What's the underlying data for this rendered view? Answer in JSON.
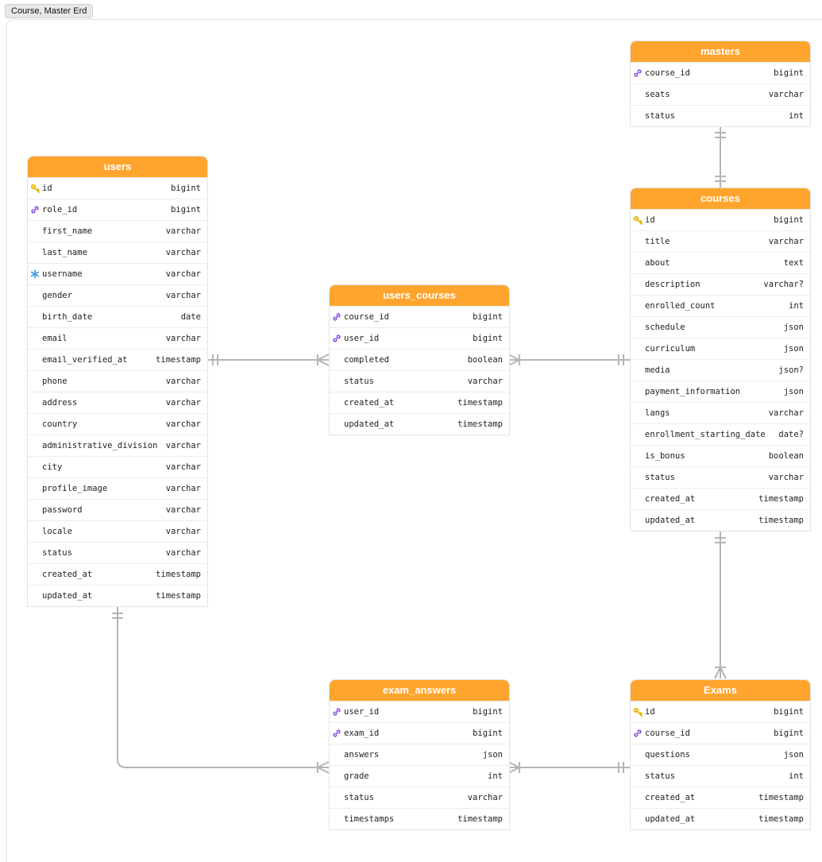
{
  "canvas_tab": "Course, Master Erd",
  "tables": {
    "masters": {
      "name": "masters",
      "columns": [
        {
          "name": "course_id",
          "type": "bigint",
          "icon": "link-icon"
        },
        {
          "name": "seats",
          "type": "varchar",
          "icon": ""
        },
        {
          "name": "status",
          "type": "int",
          "icon": ""
        }
      ]
    },
    "courses": {
      "name": "courses",
      "columns": [
        {
          "name": "id",
          "type": "bigint",
          "icon": "key-icon"
        },
        {
          "name": "title",
          "type": "varchar",
          "icon": ""
        },
        {
          "name": "about",
          "type": "text",
          "icon": ""
        },
        {
          "name": "description",
          "type": "varchar?",
          "icon": ""
        },
        {
          "name": "enrolled_count",
          "type": "int",
          "icon": ""
        },
        {
          "name": "schedule",
          "type": "json",
          "icon": ""
        },
        {
          "name": "curriculum",
          "type": "json",
          "icon": ""
        },
        {
          "name": "media",
          "type": "json?",
          "icon": ""
        },
        {
          "name": "payment_information",
          "type": "json",
          "icon": ""
        },
        {
          "name": "langs",
          "type": "varchar",
          "icon": ""
        },
        {
          "name": "enrollment_starting_date",
          "type": "date?",
          "icon": ""
        },
        {
          "name": "is_bonus",
          "type": "boolean",
          "icon": ""
        },
        {
          "name": "status",
          "type": "varchar",
          "icon": ""
        },
        {
          "name": "created_at",
          "type": "timestamp",
          "icon": ""
        },
        {
          "name": "updated_at",
          "type": "timestamp",
          "icon": ""
        }
      ]
    },
    "users": {
      "name": "users",
      "columns": [
        {
          "name": "id",
          "type": "bigint",
          "icon": "key-icon"
        },
        {
          "name": "role_id",
          "type": "bigint",
          "icon": "link-icon"
        },
        {
          "name": "first_name",
          "type": "varchar",
          "icon": ""
        },
        {
          "name": "last_name",
          "type": "varchar",
          "icon": ""
        },
        {
          "name": "username",
          "type": "varchar",
          "icon": "unique-icon"
        },
        {
          "name": "gender",
          "type": "varchar",
          "icon": ""
        },
        {
          "name": "birth_date",
          "type": "date",
          "icon": ""
        },
        {
          "name": "email",
          "type": "varchar",
          "icon": ""
        },
        {
          "name": "email_verified_at",
          "type": "timestamp",
          "icon": ""
        },
        {
          "name": "phone",
          "type": "varchar",
          "icon": ""
        },
        {
          "name": "address",
          "type": "varchar",
          "icon": ""
        },
        {
          "name": "country",
          "type": "varchar",
          "icon": ""
        },
        {
          "name": "administrative_division",
          "type": "varchar",
          "icon": ""
        },
        {
          "name": "city",
          "type": "varchar",
          "icon": ""
        },
        {
          "name": "profile_image",
          "type": "varchar",
          "icon": ""
        },
        {
          "name": "password",
          "type": "varchar",
          "icon": ""
        },
        {
          "name": "locale",
          "type": "varchar",
          "icon": ""
        },
        {
          "name": "status",
          "type": "varchar",
          "icon": ""
        },
        {
          "name": "created_at",
          "type": "timestamp",
          "icon": ""
        },
        {
          "name": "updated_at",
          "type": "timestamp",
          "icon": ""
        }
      ]
    },
    "users_courses": {
      "name": "users_courses",
      "columns": [
        {
          "name": "course_id",
          "type": "bigint",
          "icon": "link-icon"
        },
        {
          "name": "user_id",
          "type": "bigint",
          "icon": "link-icon"
        },
        {
          "name": "completed",
          "type": "boolean",
          "icon": ""
        },
        {
          "name": "status",
          "type": "varchar",
          "icon": ""
        },
        {
          "name": "created_at",
          "type": "timestamp",
          "icon": ""
        },
        {
          "name": "updated_at",
          "type": "timestamp",
          "icon": ""
        }
      ]
    },
    "exam_answers": {
      "name": "exam_answers",
      "columns": [
        {
          "name": "user_id",
          "type": "bigint",
          "icon": "link-icon"
        },
        {
          "name": "exam_id",
          "type": "bigint",
          "icon": "link-icon"
        },
        {
          "name": "answers",
          "type": "json",
          "icon": ""
        },
        {
          "name": "grade",
          "type": "int",
          "icon": ""
        },
        {
          "name": "status",
          "type": "varchar",
          "icon": ""
        },
        {
          "name": "timestamps",
          "type": "timestamp",
          "icon": ""
        }
      ]
    },
    "exams": {
      "name": "Exams",
      "columns": [
        {
          "name": "id",
          "type": "bigint",
          "icon": "key-icon"
        },
        {
          "name": "course_id",
          "type": "bigint",
          "icon": "link-icon"
        },
        {
          "name": "questions",
          "type": "json",
          "icon": ""
        },
        {
          "name": "status",
          "type": "int",
          "icon": ""
        },
        {
          "name": "created_at",
          "type": "timestamp",
          "icon": ""
        },
        {
          "name": "updated_at",
          "type": "timestamp",
          "icon": ""
        }
      ]
    }
  },
  "colors": {
    "header": "#ffa52e",
    "connector": "#b5b5b5",
    "key": "#e8b400",
    "link": "#8a4de0",
    "unique": "#3a9ad9"
  }
}
